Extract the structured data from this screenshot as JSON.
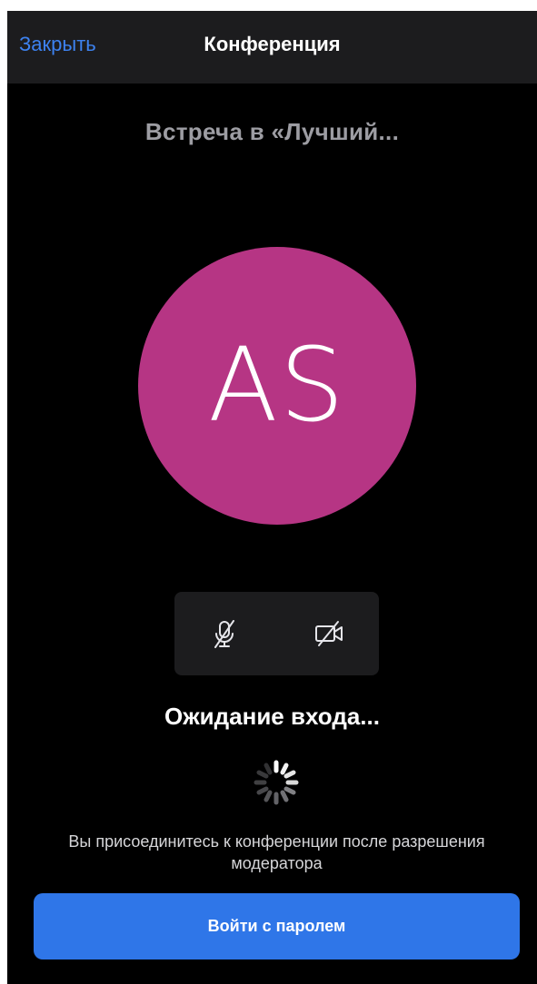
{
  "navbar": {
    "close_label": "Закрыть",
    "title": "Конференция"
  },
  "meeting": {
    "title": "Встреча в «Лучший..."
  },
  "avatar": {
    "initials": "AS",
    "color": "#b63584"
  },
  "controls": {
    "microphone": {
      "icon": "microphone-off-icon",
      "state": "muted"
    },
    "camera": {
      "icon": "camera-off-icon",
      "state": "off"
    }
  },
  "status": {
    "title": "Ожидание входа...",
    "hint": "Вы присоединитесь к конференции после разрешения модератора"
  },
  "join_button": {
    "label": "Войти с паролем",
    "color": "#2f76e8"
  },
  "colors": {
    "accent": "#3d82f0",
    "background": "#000000",
    "panel": "#1c1c1e"
  }
}
